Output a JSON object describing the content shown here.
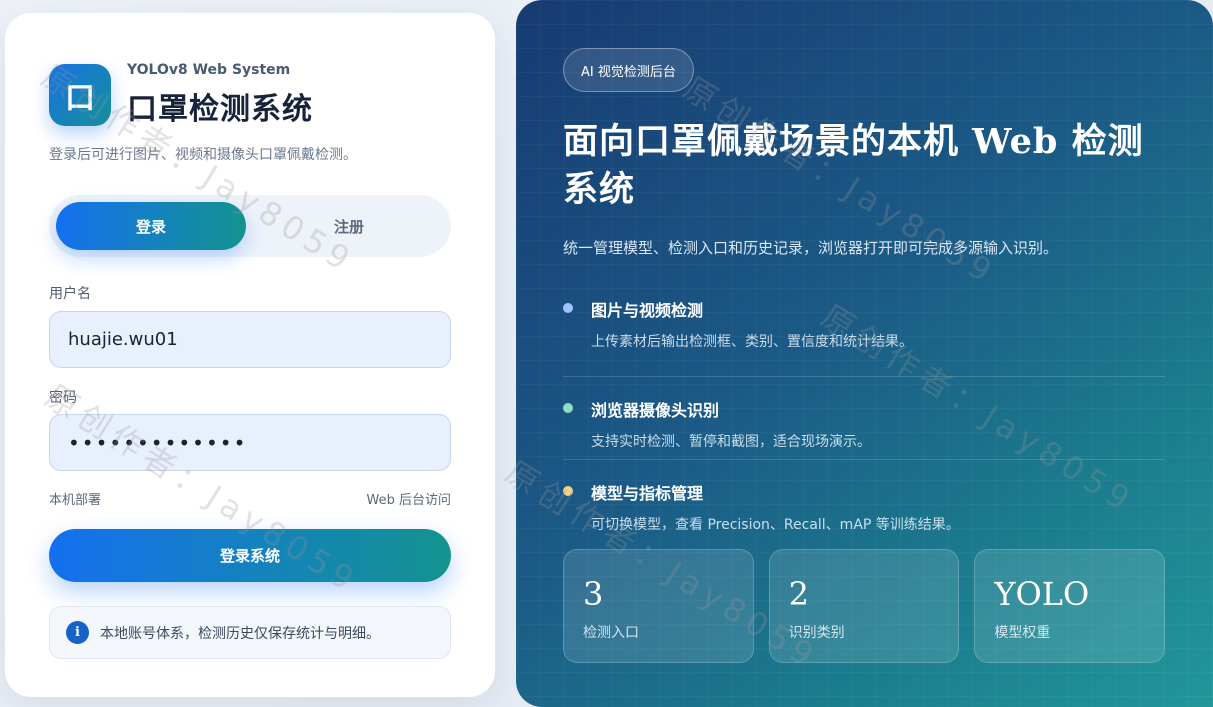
{
  "brand": {
    "logo_glyph": "口",
    "subtitle": "YOLOv8 Web System",
    "title": "口罩检测系统",
    "description": "登录后可进行图片、视频和摄像头口罩佩戴检测。"
  },
  "tabs": [
    {
      "label": "登录",
      "active": true
    },
    {
      "label": "注册",
      "active": false
    }
  ],
  "form": {
    "username_label": "用户名",
    "username_value": "huajie.wu01",
    "password_label": "密码",
    "password_value": "•••••••••••••",
    "meta_left": "本机部署",
    "meta_right": "Web 后台访问",
    "submit_label": "登录系统",
    "notice_icon": "i",
    "notice_text": "本地账号体系，检测历史仅保存统计与明细。"
  },
  "hero": {
    "badge": "AI 视觉检测后台",
    "title": "面向口罩佩戴场景的本机 Web 检测系统",
    "description": "统一管理模型、检测入口和历史记录，浏览器打开即可完成多源输入识别。",
    "features": [
      {
        "title": "图片与视频检测",
        "desc": "上传素材后输出检测框、类别、置信度和统计结果。",
        "dot_color": "#9ec4ff"
      },
      {
        "title": "浏览器摄像头识别",
        "desc": "支持实时检测、暂停和截图，适合现场演示。",
        "dot_color": "#8fe0be"
      },
      {
        "title": "模型与指标管理",
        "desc": "可切换模型，查看 Precision、Recall、mAP 等训练结果。",
        "dot_color": "#f6cf86"
      }
    ],
    "stats": [
      {
        "value": "3",
        "label": "检测入口"
      },
      {
        "value": "2",
        "label": "识别类别"
      },
      {
        "value": "YOLO",
        "label": "模型权重"
      }
    ]
  },
  "watermark": "原创作者：Jay8059",
  "colors": {
    "accent_start": "#1470f0",
    "accent_end": "#14938f",
    "hero_dark": "#173b72",
    "hero_light": "#21979a"
  }
}
